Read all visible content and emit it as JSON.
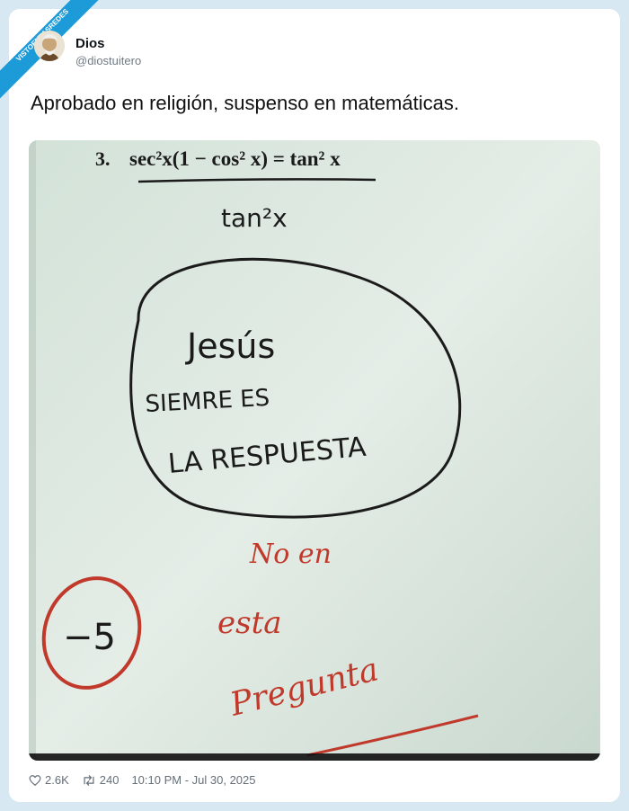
{
  "badge": {
    "line1": "VISTOENLASREDES",
    "line2": ".com"
  },
  "author": {
    "name": "Dios",
    "handle": "@diostuitero"
  },
  "tweet": {
    "text": "Aprobado en religión, suspenso en matemáticas."
  },
  "photo": {
    "problem_number": "3.",
    "equation": "sec²x(1 − cos² x) = tan² x",
    "answer": "tan²x",
    "circled_lines": [
      "Jesús",
      "SIEMRE ES",
      "LA RESPUESTA"
    ],
    "red_lines": [
      "No en",
      "esta",
      "Pregunta"
    ],
    "score": "−5"
  },
  "stats": {
    "likes": "2.6K",
    "retweets": "240",
    "timestamp": "10:10 PM - Jul 30, 2025"
  },
  "colors": {
    "ink": "#1b1b1b",
    "red_pen": "#c0392b",
    "paper": "#dae7de",
    "accent": "#1d9bd8"
  }
}
